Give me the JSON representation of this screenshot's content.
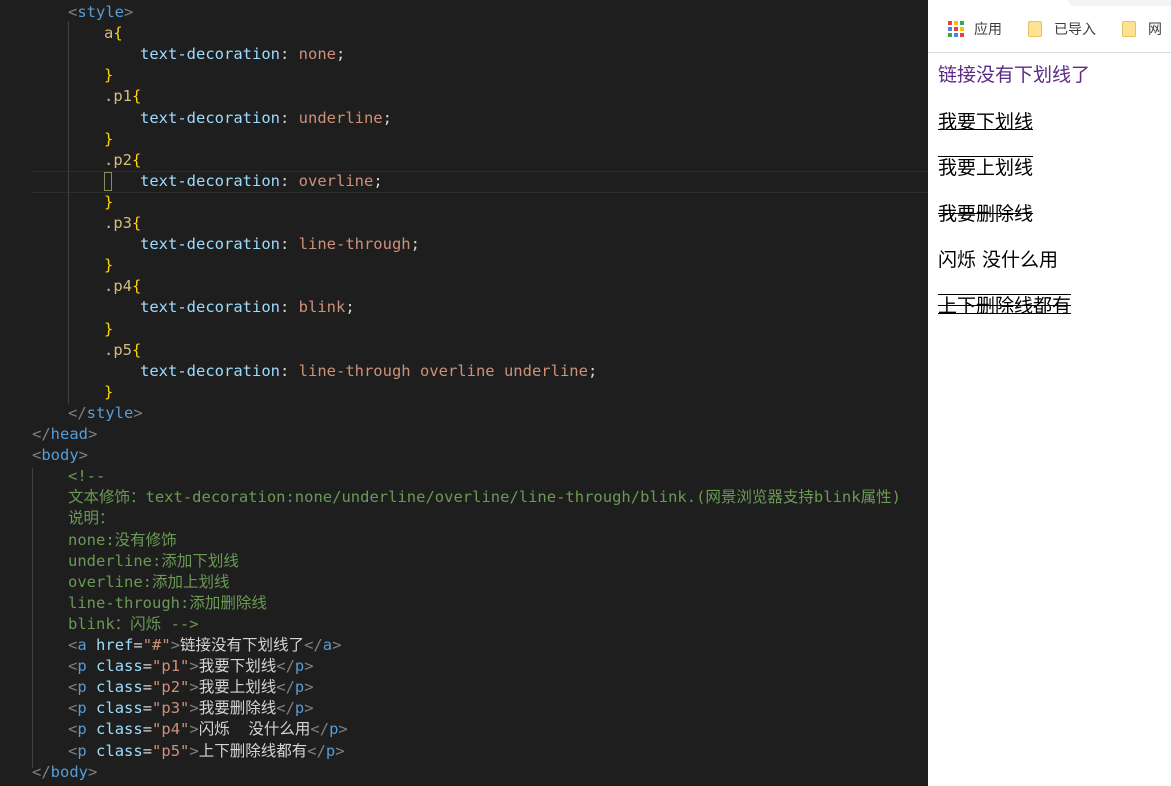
{
  "editor": {
    "lines": [
      [
        [
          "t-punc",
          "<"
        ],
        [
          "t-tag",
          "style"
        ],
        [
          "t-punc",
          ">"
        ]
      ],
      [
        [
          "t-sel",
          "a"
        ],
        [
          "t-brace",
          "{"
        ]
      ],
      [
        [
          "t-prop",
          "text-decoration"
        ],
        [
          "t-colon",
          ": "
        ],
        [
          "t-val",
          "none"
        ],
        [
          "t-colon",
          ";"
        ]
      ],
      [
        [
          "t-brace",
          "}"
        ]
      ],
      [
        [
          "t-sel",
          ".p1"
        ],
        [
          "t-brace",
          "{"
        ]
      ],
      [
        [
          "t-prop",
          "text-decoration"
        ],
        [
          "t-colon",
          ": "
        ],
        [
          "t-val",
          "underline"
        ],
        [
          "t-colon",
          ";"
        ]
      ],
      [
        [
          "t-brace",
          "}"
        ]
      ],
      [
        [
          "t-sel",
          ".p2"
        ],
        [
          "t-brace",
          "{"
        ]
      ],
      [
        [
          "t-prop",
          "text-decoration"
        ],
        [
          "t-colon",
          ": "
        ],
        [
          "t-val",
          "overline"
        ],
        [
          "t-colon",
          ";"
        ]
      ],
      [
        [
          "t-brace",
          "}"
        ]
      ],
      [
        [
          "t-sel",
          ".p3"
        ],
        [
          "t-brace",
          "{"
        ]
      ],
      [
        [
          "t-prop",
          "text-decoration"
        ],
        [
          "t-colon",
          ": "
        ],
        [
          "t-val",
          "line-through"
        ],
        [
          "t-colon",
          ";"
        ]
      ],
      [
        [
          "t-brace",
          "}"
        ]
      ],
      [
        [
          "t-sel",
          ".p4"
        ],
        [
          "t-brace",
          "{"
        ]
      ],
      [
        [
          "t-prop",
          "text-decoration"
        ],
        [
          "t-colon",
          ": "
        ],
        [
          "t-val",
          "blink"
        ],
        [
          "t-colon",
          ";"
        ]
      ],
      [
        [
          "t-brace",
          "}"
        ]
      ],
      [
        [
          "t-sel",
          ".p5"
        ],
        [
          "t-brace",
          "{"
        ]
      ],
      [
        [
          "t-prop",
          "text-decoration"
        ],
        [
          "t-colon",
          ": "
        ],
        [
          "t-val",
          "line-through overline underline"
        ],
        [
          "t-colon",
          ";"
        ]
      ],
      [
        [
          "t-brace",
          "}"
        ]
      ],
      [
        [
          "t-punc",
          "</"
        ],
        [
          "t-tag",
          "style"
        ],
        [
          "t-punc",
          ">"
        ]
      ],
      [
        [
          "t-punc",
          "</"
        ],
        [
          "t-tag",
          "head"
        ],
        [
          "t-punc",
          ">"
        ]
      ],
      [
        [
          "t-punc",
          "<"
        ],
        [
          "t-tag",
          "body"
        ],
        [
          "t-punc",
          ">"
        ]
      ],
      [
        [
          "t-com",
          "<!--"
        ]
      ],
      [
        [
          "t-com",
          "文本修饰：text-decoration:none/underline/overline/line-through/blink.(网景浏览器支持blink属性)"
        ]
      ],
      [
        [
          "t-com",
          "说明："
        ]
      ],
      [
        [
          "t-com",
          "none:没有修饰"
        ]
      ],
      [
        [
          "t-com",
          "underline:添加下划线"
        ]
      ],
      [
        [
          "t-com",
          "overline:添加上划线"
        ]
      ],
      [
        [
          "t-com",
          "line-through:添加删除线"
        ]
      ],
      [
        [
          "t-com",
          "blink：闪烁 -->"
        ]
      ],
      [
        [
          "t-punc",
          "<"
        ],
        [
          "t-tag",
          "a"
        ],
        [
          "t-txt",
          " "
        ],
        [
          "t-attr",
          "href"
        ],
        [
          "t-txt",
          "="
        ],
        [
          "t-str",
          "\"#\""
        ],
        [
          "t-punc",
          ">"
        ],
        [
          "t-txt",
          "链接没有下划线了"
        ],
        [
          "t-punc",
          "</"
        ],
        [
          "t-tag",
          "a"
        ],
        [
          "t-punc",
          ">"
        ]
      ],
      [
        [
          "t-punc",
          "<"
        ],
        [
          "t-tag",
          "p"
        ],
        [
          "t-txt",
          " "
        ],
        [
          "t-attr",
          "class"
        ],
        [
          "t-txt",
          "="
        ],
        [
          "t-str",
          "\"p1\""
        ],
        [
          "t-punc",
          ">"
        ],
        [
          "t-txt",
          "我要下划线"
        ],
        [
          "t-punc",
          "</"
        ],
        [
          "t-tag",
          "p"
        ],
        [
          "t-punc",
          ">"
        ]
      ],
      [
        [
          "t-punc",
          "<"
        ],
        [
          "t-tag",
          "p"
        ],
        [
          "t-txt",
          " "
        ],
        [
          "t-attr",
          "class"
        ],
        [
          "t-txt",
          "="
        ],
        [
          "t-str",
          "\"p2\""
        ],
        [
          "t-punc",
          ">"
        ],
        [
          "t-txt",
          "我要上划线"
        ],
        [
          "t-punc",
          "</"
        ],
        [
          "t-tag",
          "p"
        ],
        [
          "t-punc",
          ">"
        ]
      ],
      [
        [
          "t-punc",
          "<"
        ],
        [
          "t-tag",
          "p"
        ],
        [
          "t-txt",
          " "
        ],
        [
          "t-attr",
          "class"
        ],
        [
          "t-txt",
          "="
        ],
        [
          "t-str",
          "\"p3\""
        ],
        [
          "t-punc",
          ">"
        ],
        [
          "t-txt",
          "我要删除线"
        ],
        [
          "t-punc",
          "</"
        ],
        [
          "t-tag",
          "p"
        ],
        [
          "t-punc",
          ">"
        ]
      ],
      [
        [
          "t-punc",
          "<"
        ],
        [
          "t-tag",
          "p"
        ],
        [
          "t-txt",
          " "
        ],
        [
          "t-attr",
          "class"
        ],
        [
          "t-txt",
          "="
        ],
        [
          "t-str",
          "\"p4\""
        ],
        [
          "t-punc",
          ">"
        ],
        [
          "t-txt",
          "闪烁  没什么用"
        ],
        [
          "t-punc",
          "</"
        ],
        [
          "t-tag",
          "p"
        ],
        [
          "t-punc",
          ">"
        ]
      ],
      [
        [
          "t-punc",
          "<"
        ],
        [
          "t-tag",
          "p"
        ],
        [
          "t-txt",
          " "
        ],
        [
          "t-attr",
          "class"
        ],
        [
          "t-txt",
          "="
        ],
        [
          "t-str",
          "\"p5\""
        ],
        [
          "t-punc",
          ">"
        ],
        [
          "t-txt",
          "上下删除线都有"
        ],
        [
          "t-punc",
          "</"
        ],
        [
          "t-tag",
          "p"
        ],
        [
          "t-punc",
          ">"
        ]
      ],
      [
        [
          "t-punc",
          "</"
        ],
        [
          "t-tag",
          "body"
        ],
        [
          "t-punc",
          ">"
        ]
      ]
    ]
  },
  "bookmarks": {
    "apps_label": "应用",
    "folder1": "已导入",
    "folder2": "网"
  },
  "page": {
    "link": "链接没有下划线了",
    "p1": "我要下划线",
    "p2": "我要上划线",
    "p3": "我要删除线",
    "p4": "闪烁 没什么用",
    "p5": "上下删除线都有"
  },
  "colors": {
    "apps_grid": [
      "#ea4335",
      "#fbbc05",
      "#34a853",
      "#4285f4",
      "#ea4335",
      "#fbbc05",
      "#34a853",
      "#4285f4",
      "#ea4335"
    ]
  }
}
